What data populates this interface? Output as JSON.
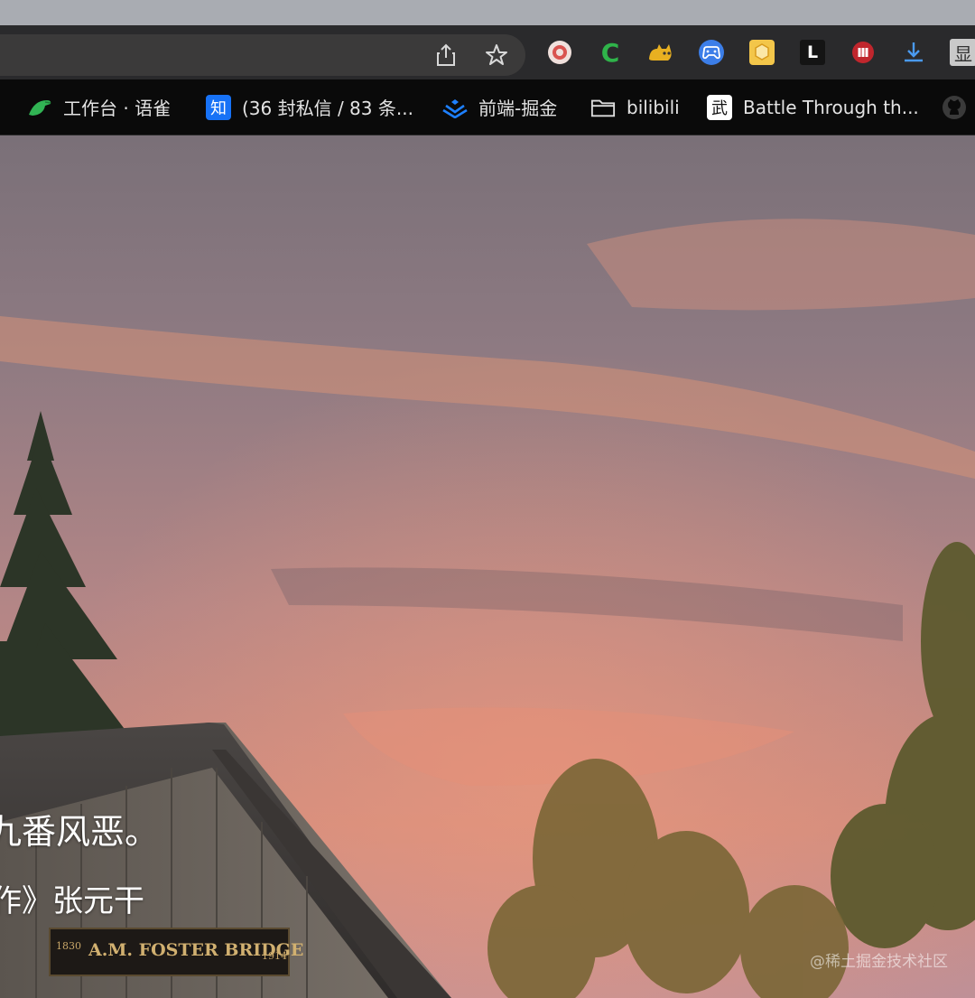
{
  "browser": {
    "toolbar": {
      "extensions": [
        {
          "name": "donut-extension-icon"
        },
        {
          "name": "c-extension-icon",
          "glyph": "C"
        },
        {
          "name": "cat-extension-icon"
        },
        {
          "name": "gamepad-extension-icon"
        },
        {
          "name": "honeycomb-extension-icon"
        },
        {
          "name": "lighthouse-extension-icon",
          "glyph": "L"
        },
        {
          "name": "red-circle-extension-icon"
        },
        {
          "name": "download-icon"
        },
        {
          "name": "display-extension-icon",
          "glyph": "显"
        }
      ]
    },
    "bookmarks": [
      {
        "label": "工作台 · 语雀",
        "icon": "yuque-bird-icon"
      },
      {
        "label": "(36 封私信 / 83 条...",
        "icon": "zhihu-icon",
        "icon_glyph": "知"
      },
      {
        "label": "前端-掘金",
        "icon": "juejin-icon"
      },
      {
        "label": "bilibili",
        "icon": "folder-icon"
      },
      {
        "label": "Battle Through th...",
        "icon": "wu-icon",
        "icon_glyph": "武"
      },
      {
        "label": "",
        "icon": "github-icon"
      }
    ]
  },
  "page": {
    "poem_line_1": "九番风恶。",
    "poem_line_2": "作》张元干",
    "sign_text": "A.M. FOSTER BRIDGE",
    "sign_year_left": "1830",
    "sign_year_right": "1914",
    "watermark": "@稀土掘金技术社区"
  },
  "colors": {
    "toolbar_bg": "#2a2a2c",
    "omnibox_bg": "#3b3a3a",
    "bookmarks_bg": "#0a0a0a",
    "sky_top": "#7e7178",
    "sky_glow": "#d98a7a"
  }
}
